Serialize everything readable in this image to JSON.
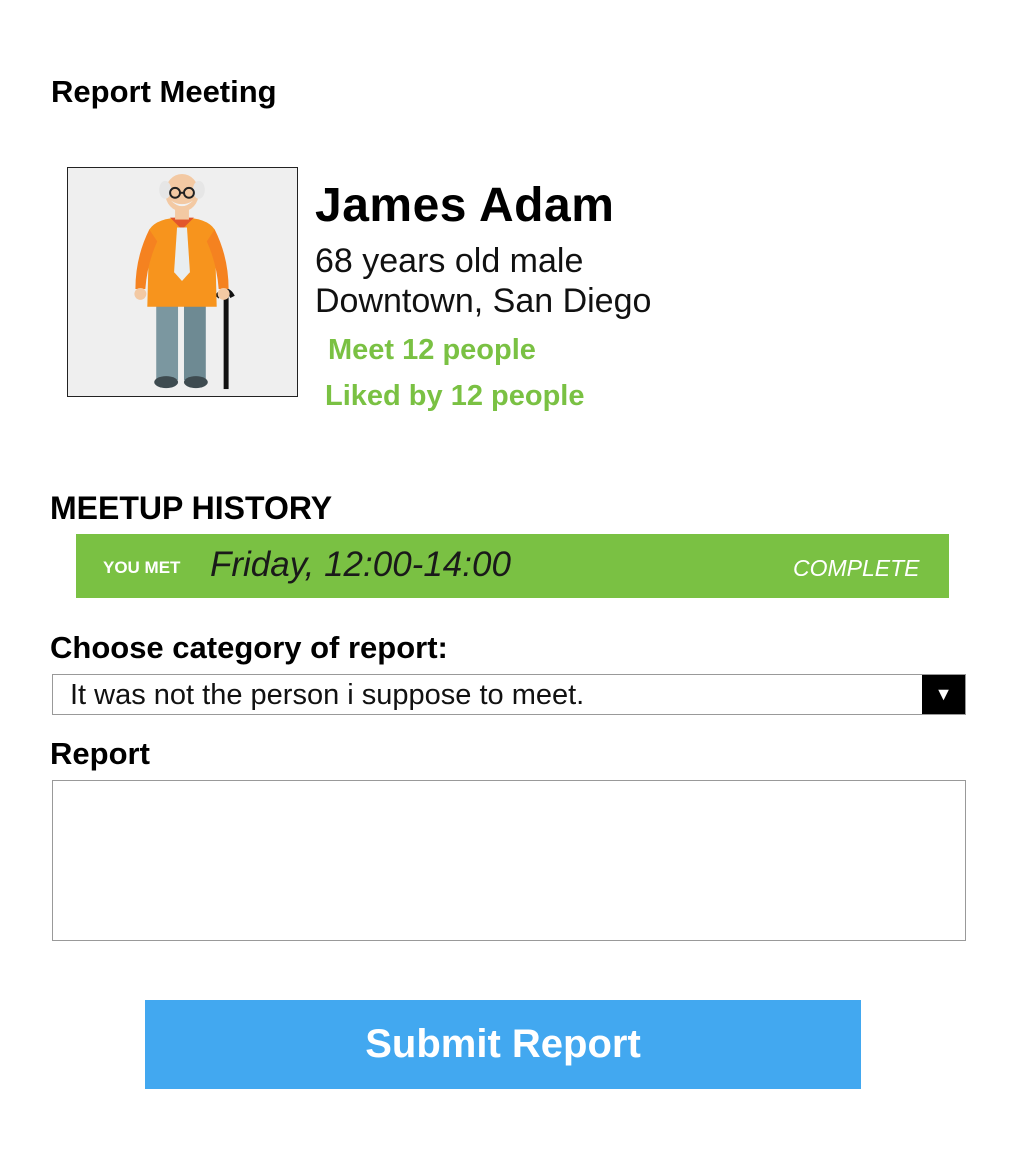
{
  "page": {
    "title": "Report Meeting"
  },
  "profile": {
    "avatar_icon": "elderly-man-with-cane-avatar",
    "name": "James Adam",
    "age_gender": "68 years old male",
    "location": "Downtown, San Diego",
    "meet_count": "Meet 12 people",
    "liked_by": "Liked by 12 people"
  },
  "history": {
    "title": "MEETUP HISTORY",
    "entries": [
      {
        "label": "YOU MET",
        "time": "Friday, 12:00-14:00",
        "status": "COMPLETE"
      }
    ]
  },
  "category": {
    "label": "Choose category of report:",
    "selected": "It was not the person i suppose to meet.",
    "arrow_icon": "triangle-down-icon"
  },
  "report": {
    "label": "Report",
    "value": ""
  },
  "submit": {
    "label": "Submit Report"
  },
  "colors": {
    "accent_green": "#7ac143",
    "submit_blue": "#42a8f0"
  }
}
